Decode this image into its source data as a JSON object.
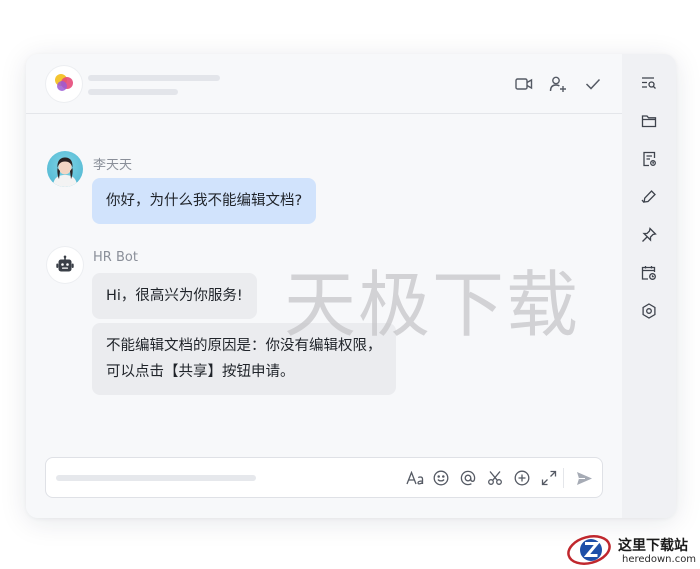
{
  "chat": {
    "messages": [
      {
        "sender": "李天天",
        "avatar": "user-avatar",
        "bubbles": [
          "你好，为什么我不能编辑文档?"
        ]
      },
      {
        "sender": "HR Bot",
        "avatar": "robot-icon",
        "bubbles": [
          "Hi，很高兴为你服务!",
          "不能编辑文档的原因是：你没有编辑权限，",
          "可以点击【共享】按钮申请。"
        ]
      }
    ]
  },
  "header": {
    "icons": [
      "video-icon",
      "add-member-icon",
      "check-icon"
    ]
  },
  "composer": {
    "icons": [
      "text-format-icon",
      "emoji-icon",
      "mention-icon",
      "screenshot-scissors-icon",
      "add-icon",
      "expand-icon",
      "send-icon"
    ]
  },
  "sidebar": {
    "icons": [
      "search-list-icon",
      "folder-icon",
      "document-icon",
      "edit-check-icon",
      "pin-icon",
      "calendar-icon",
      "settings-icon"
    ]
  },
  "watermark": "天极下载",
  "site_logo": {
    "cn": "这里下载站",
    "en": "heredown.com"
  },
  "colors": {
    "user_bubble": "#d1e3fc",
    "bot_bubble": "#ebecef",
    "accent": "#4a7fe0"
  }
}
